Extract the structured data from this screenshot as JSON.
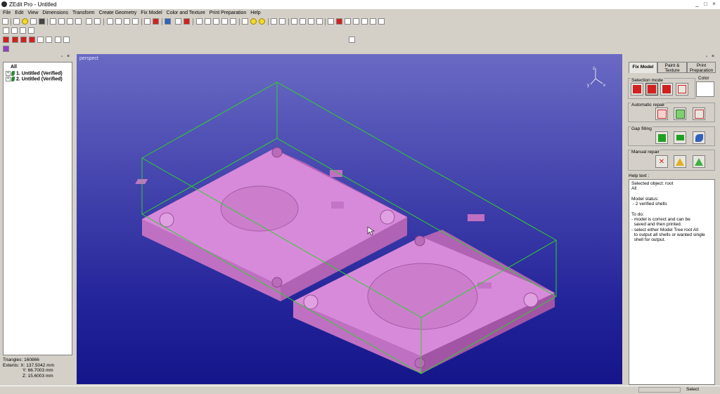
{
  "window": {
    "title": "ZEdit Pro - Untitled"
  },
  "menu": [
    "File",
    "Edit",
    "View",
    "Dimensions",
    "Transform",
    "Create Geometry",
    "Fix Model",
    "Color and Texture",
    "Print Preparation",
    "Help"
  ],
  "tree": {
    "root": "All",
    "items": [
      "1. Untitled (Verified)",
      "2. Untitled (Verified)"
    ]
  },
  "stats": {
    "triangles_label": "Triangles:",
    "triangles": "160866",
    "extents_label": "Extents:",
    "x": "X: 137.5042 mm",
    "y": "Y: 66.7003 mm",
    "z": "Z: 15.6003 mm"
  },
  "viewport": {
    "label": "perspect"
  },
  "right_panel": {
    "tabs": [
      "Fix Model",
      "Paint & Texture",
      "Print Preparation"
    ],
    "groups": {
      "selection_mode": "Selection mode",
      "color": "Color",
      "automatic_repair": "Automatic repair",
      "gap_filling": "Gap filling",
      "manual_repair": "Manual repair"
    },
    "help_label": "Help text :",
    "help_text": "Selected object: root\nAll\n\nModel status:\n - 2 verified shells\n\nTo do:\n- model is correct and can be\n  saved and then printed.\n- select either Model Tree root All\n  to output all shells or wanted single\n  shell for output."
  },
  "status": {
    "right": "Select"
  },
  "colors": {
    "model": "#d782d9",
    "bbox": "#2fd02f",
    "accent": "#0a246a"
  }
}
